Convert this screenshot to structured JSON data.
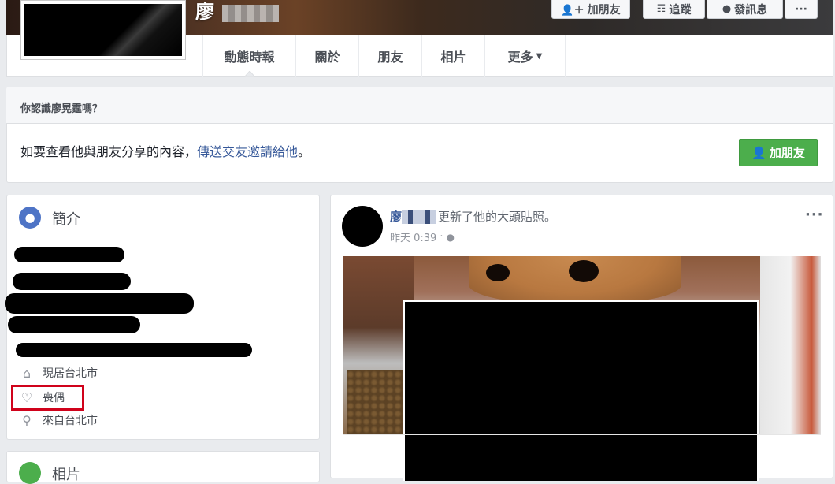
{
  "header": {
    "name_visible": "廖",
    "buttons": {
      "add_friend": "加朋友",
      "follow": "追蹤",
      "message": "發訊息",
      "more": "···"
    },
    "tabs": [
      {
        "label": "動態時報",
        "active": true
      },
      {
        "label": "關於"
      },
      {
        "label": "朋友"
      },
      {
        "label": "相片"
      },
      {
        "label": "更多"
      }
    ]
  },
  "friend_request": {
    "title": "你認識廖晃霆嗎？",
    "body_prefix": "如要查看他與朋友分享的內容，",
    "body_link": "傳送交友邀請給他",
    "body_suffix": "。",
    "button": "加朋友"
  },
  "intro": {
    "title": "簡介",
    "rows": [
      {
        "icon": "home-icon",
        "text": "現居台北市"
      },
      {
        "icon": "heart-icon",
        "text": "喪偶"
      },
      {
        "icon": "location-pin-icon",
        "text": "來自台北市"
      }
    ]
  },
  "second_card": {
    "title": "相片"
  },
  "post": {
    "author_visible": "廖",
    "action": "更新了他的大頭貼照。",
    "time": "昨天 0:39",
    "privacy_icon": "globe-icon",
    "more": "···"
  },
  "colors": {
    "page_bg": "#e9ebee",
    "link": "#365899",
    "add_friend_green": "#4cae4c",
    "highlight_red": "#d0021b"
  }
}
